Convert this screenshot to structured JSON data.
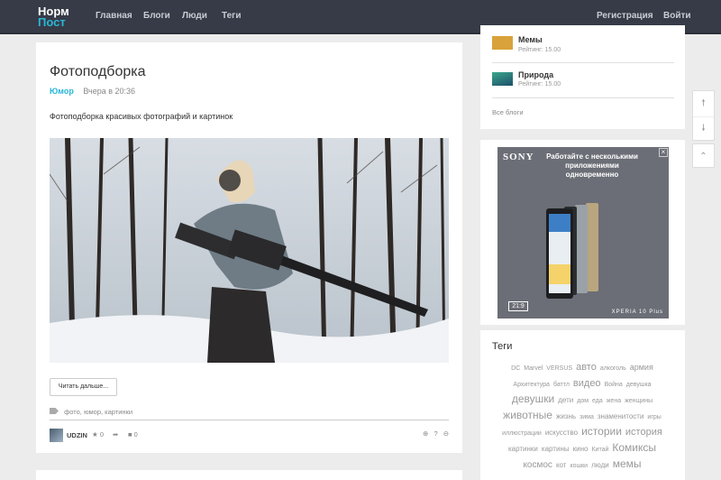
{
  "header": {
    "logo_line1": "Норм",
    "logo_line2": "Пост",
    "nav": [
      "Главная",
      "Блоги",
      "Люди",
      "Теги"
    ],
    "register": "Регистрация",
    "login": "Войти"
  },
  "post": {
    "title": "Фотоподборка",
    "category": "Юмор",
    "time": "Вчера в 20:36",
    "description": "Фотоподборка красивых фотографий и картинок",
    "read_more": "Читать дальше...",
    "tags": "фото, юмор, картинки",
    "author": "UDZIN",
    "stars": "0",
    "comments": "0",
    "vote_score": "?"
  },
  "sidebar": {
    "blogs": [
      {
        "name": "Мемы",
        "rating": "Рейтинг: 15.00"
      },
      {
        "name": "Природа",
        "rating": "Рейтинг: 15.00"
      }
    ],
    "all_blogs": "Все блоги",
    "ad": {
      "brand": "SONY",
      "text": "Работайте с несколькими приложениями одновременно",
      "footer": "XPERIA 10 Plus",
      "badge": "21:9"
    },
    "tags_title": "Теги",
    "tag_cloud": [
      {
        "t": "DC",
        "s": 7
      },
      {
        "t": "Marvel",
        "s": 7
      },
      {
        "t": "VERSUS",
        "s": 7
      },
      {
        "t": "авто",
        "s": 11
      },
      {
        "t": "алкоголь",
        "s": 7
      },
      {
        "t": "армия",
        "s": 9
      },
      {
        "t": "Архитектура",
        "s": 7
      },
      {
        "t": "баттл",
        "s": 7
      },
      {
        "t": "видео",
        "s": 11
      },
      {
        "t": "Война",
        "s": 7
      },
      {
        "t": "девушка",
        "s": 7
      },
      {
        "t": "девушки",
        "s": 12
      },
      {
        "t": "дети",
        "s": 8
      },
      {
        "t": "дом",
        "s": 7
      },
      {
        "t": "еда",
        "s": 7
      },
      {
        "t": "жена",
        "s": 7
      },
      {
        "t": "женщины",
        "s": 7
      },
      {
        "t": "животные",
        "s": 12
      },
      {
        "t": "жизнь",
        "s": 8
      },
      {
        "t": "зима",
        "s": 7
      },
      {
        "t": "знаменитости",
        "s": 8
      },
      {
        "t": "игры",
        "s": 7
      },
      {
        "t": "иллюстрации",
        "s": 7
      },
      {
        "t": "искусство",
        "s": 8
      },
      {
        "t": "истории",
        "s": 12
      },
      {
        "t": "история",
        "s": 11
      },
      {
        "t": "картинки",
        "s": 8
      },
      {
        "t": "картины",
        "s": 8
      },
      {
        "t": "кино",
        "s": 8
      },
      {
        "t": "Китай",
        "s": 7
      },
      {
        "t": "Комиксы",
        "s": 12
      },
      {
        "t": "космос",
        "s": 10
      },
      {
        "t": "кот",
        "s": 8
      },
      {
        "t": "кошки",
        "s": 7
      },
      {
        "t": "люди",
        "s": 8
      },
      {
        "t": "мемы",
        "s": 12
      }
    ]
  },
  "colors": {
    "accent": "#29b6d6",
    "topbar": "#363b47"
  }
}
